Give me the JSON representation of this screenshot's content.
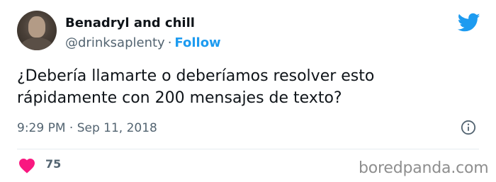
{
  "author": {
    "display_name": "Benadryl and chill",
    "handle": "@drinksaplenty",
    "separator": "·",
    "follow_label": "Follow"
  },
  "tweet": {
    "text_lines": [
      "¿Debería llamarte o deberíamos resolver esto",
      "rápidamente con 200 mensajes de texto?"
    ],
    "time": "9:29 PM",
    "date_separator": "·",
    "date": "Sep 11, 2018",
    "likes": "75"
  },
  "watermark": "boredpanda.com",
  "icons": {
    "logo": "twitter-bird-icon",
    "info": "info-icon",
    "like": "heart-icon"
  },
  "colors": {
    "accent": "#1d9bf0",
    "heart": "#f91880",
    "text": "#0f1419",
    "muted": "#536471",
    "watermark": "#8e8e8e"
  }
}
